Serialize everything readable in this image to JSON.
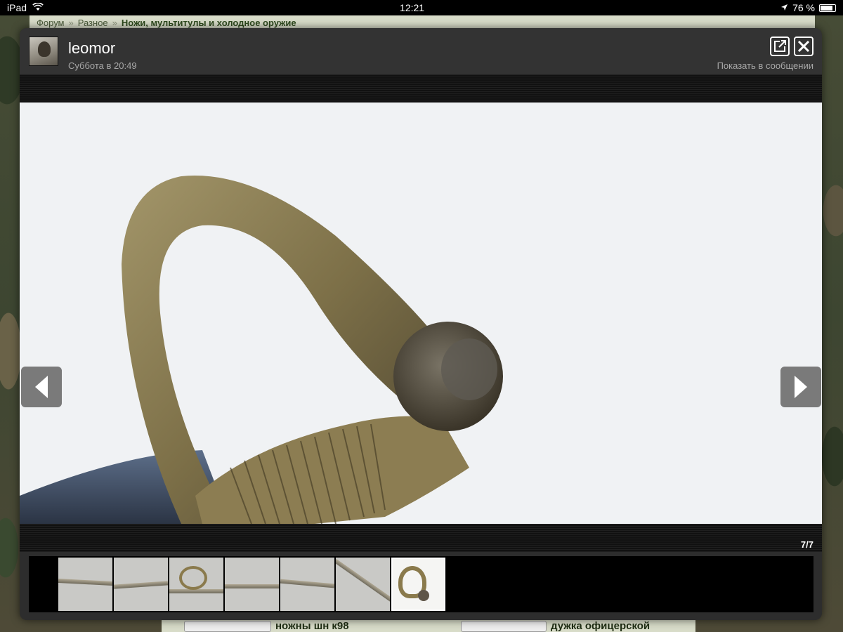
{
  "status_bar": {
    "device": "iPad",
    "time": "12:21",
    "battery": "76 %",
    "battery_level": 0.76
  },
  "breadcrumb": {
    "items": [
      "Форум",
      "Разное",
      "Ножи, мультитулы и холодное оружие"
    ],
    "separator": "»"
  },
  "lightbox": {
    "username": "leomor",
    "date": "Суббота в 20:49",
    "show_in_post": "Показать в сообщении",
    "counter": "7/7",
    "icons": {
      "open": "external-link-icon",
      "close": "close-icon",
      "prev": "arrow-left-icon",
      "next": "arrow-right-icon"
    }
  },
  "background_page": {
    "topic_left": "ножны шн к98",
    "topic_right": "дужка офицерской"
  },
  "colors": {
    "overlay_bg": "#2d2d2d",
    "photo_bg": "#f1f3f5",
    "brass": "#8a7a4c"
  }
}
